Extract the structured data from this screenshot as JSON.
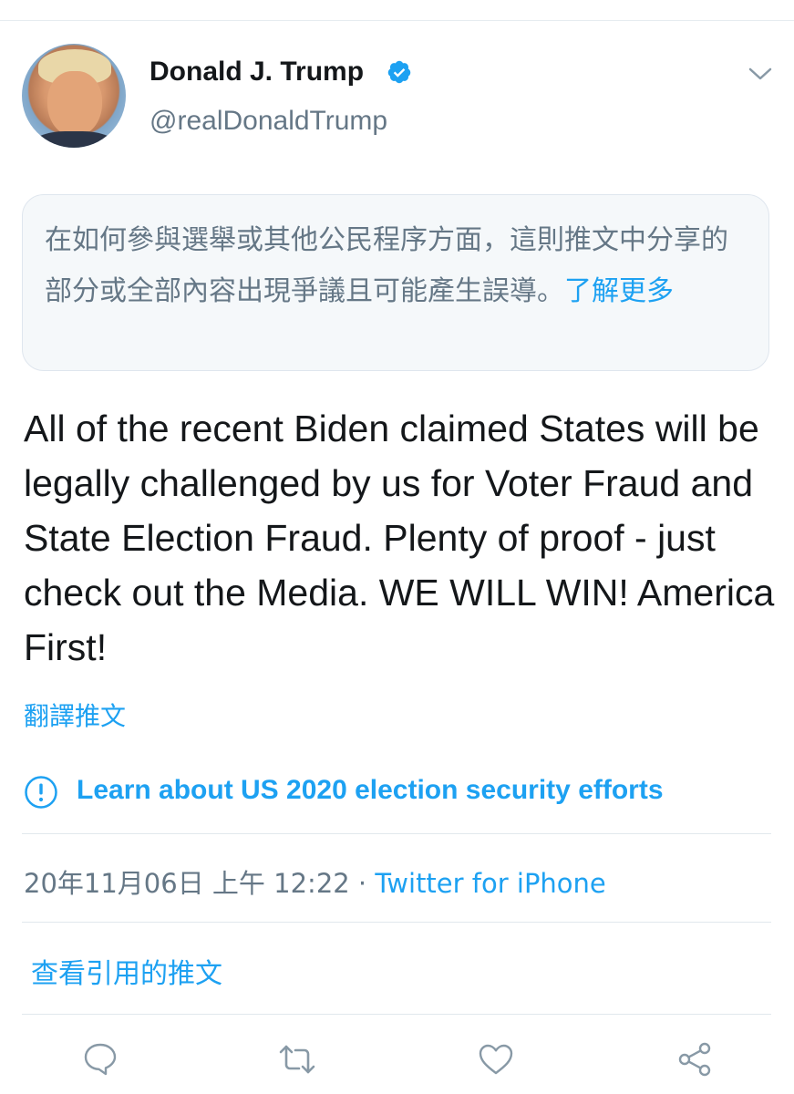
{
  "author": {
    "name": "Donald J. Trump",
    "handle": "@realDonaldTrump",
    "verified": true
  },
  "notice": {
    "text": "在如何參與選舉或其他公民程序方面，這則推文中分享的部分或全部內容出現爭議且可能產生誤導。",
    "learn_more": "了解更多"
  },
  "tweet": {
    "text": "All of the recent Biden claimed States will be legally challenged by us for Voter Fraud and State Election Fraud. Plenty of proof - just check out the Media. WE WILL WIN! America First!",
    "translate_label": "翻譯推文"
  },
  "election_label": {
    "text": "Learn about US 2020 election security efforts"
  },
  "meta": {
    "timestamp": "20年11月06日 上午 12:22",
    "separator": " · ",
    "source": "Twitter for iPhone"
  },
  "quoted": {
    "label": "查看引用的推文"
  },
  "actions": {
    "icons": [
      "reply-icon",
      "retweet-icon",
      "like-icon",
      "share-icon"
    ]
  },
  "colors": {
    "accent": "#1da1f2",
    "secondary_text": "#657786",
    "primary_text": "#14171a",
    "notice_background": "#f5f8fa",
    "divider": "#e1e8ed"
  }
}
